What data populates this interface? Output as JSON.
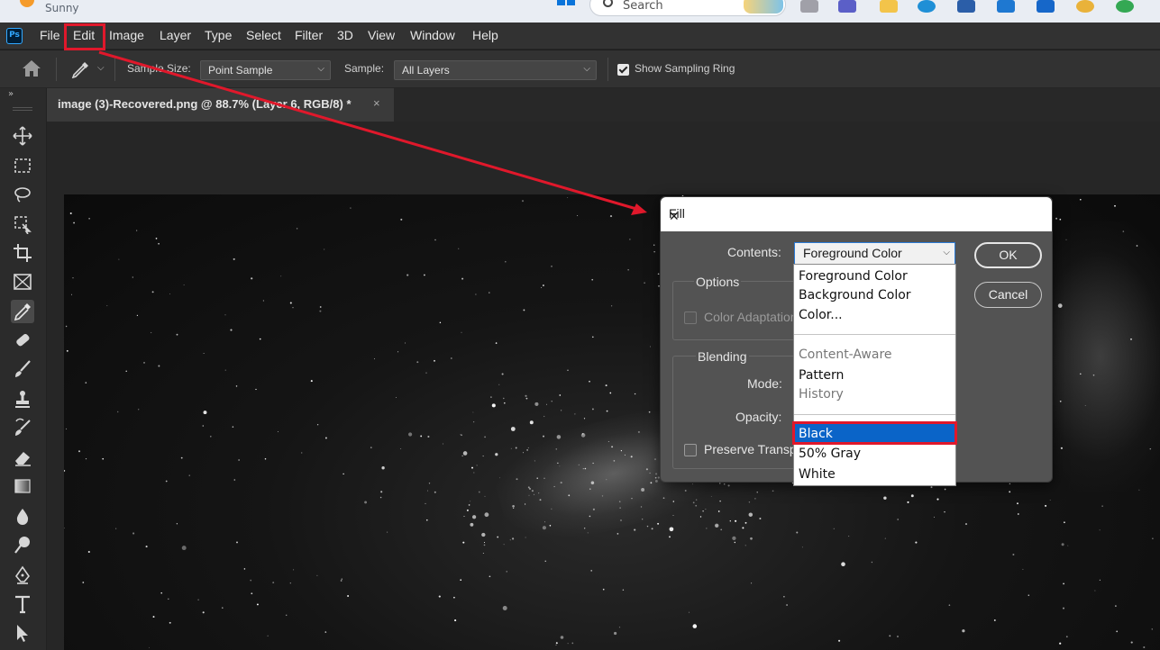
{
  "taskbar": {
    "weather_text": "Sunny",
    "search_placeholder": "Search"
  },
  "app": {
    "logo": "Ps"
  },
  "menubar": {
    "items": [
      "File",
      "Edit",
      "Image",
      "Layer",
      "Type",
      "Select",
      "Filter",
      "3D",
      "View",
      "Window",
      "Help"
    ],
    "highlighted": "Edit"
  },
  "options_bar": {
    "sample_size_label": "Sample Size:",
    "sample_size_value": "Point Sample",
    "sample_label": "Sample:",
    "sample_value": "All Layers",
    "show_ring_label": "Show Sampling Ring",
    "show_ring_checked": true
  },
  "document_tab": {
    "title": "image (3)-Recovered.png @ 88.7% (Layer 6, RGB/8) *",
    "close": "×"
  },
  "tools": [
    "move-tool-icon",
    "marquee-tool-icon",
    "lasso-tool-icon",
    "object-select-tool-icon",
    "crop-tool-icon",
    "frame-tool-icon",
    "eyedropper-tool-icon",
    "healing-brush-tool-icon",
    "brush-tool-icon",
    "clone-stamp-tool-icon",
    "history-brush-tool-icon",
    "eraser-tool-icon",
    "gradient-tool-icon",
    "blur-tool-icon",
    "dodge-tool-icon",
    "pen-tool-icon",
    "type-tool-icon",
    "path-select-tool-icon"
  ],
  "fill_dialog": {
    "title": "Fill",
    "close": "✕",
    "contents_label": "Contents:",
    "contents_value": "Foreground Color",
    "options_legend": "Options",
    "color_adaptation_label": "Color Adaptation",
    "blending_legend": "Blending",
    "mode_label": "Mode:",
    "opacity_label": "Opacity:",
    "preserve_label": "Preserve Transparency",
    "ok_label": "OK",
    "cancel_label": "Cancel"
  },
  "contents_dropdown": {
    "items": [
      {
        "label": "Foreground Color",
        "state": "normal"
      },
      {
        "label": "Background Color",
        "state": "normal"
      },
      {
        "label": "Color...",
        "state": "normal"
      },
      {
        "label": "Content-Aware",
        "state": "disabled"
      },
      {
        "label": "Pattern",
        "state": "normal"
      },
      {
        "label": "History",
        "state": "disabled"
      },
      {
        "label": "Black",
        "state": "selected"
      },
      {
        "label": "50% Gray",
        "state": "normal"
      },
      {
        "label": "White",
        "state": "normal"
      }
    ]
  },
  "annotation_colors": {
    "highlight": "#e0182b",
    "selection": "#0a64c8"
  }
}
